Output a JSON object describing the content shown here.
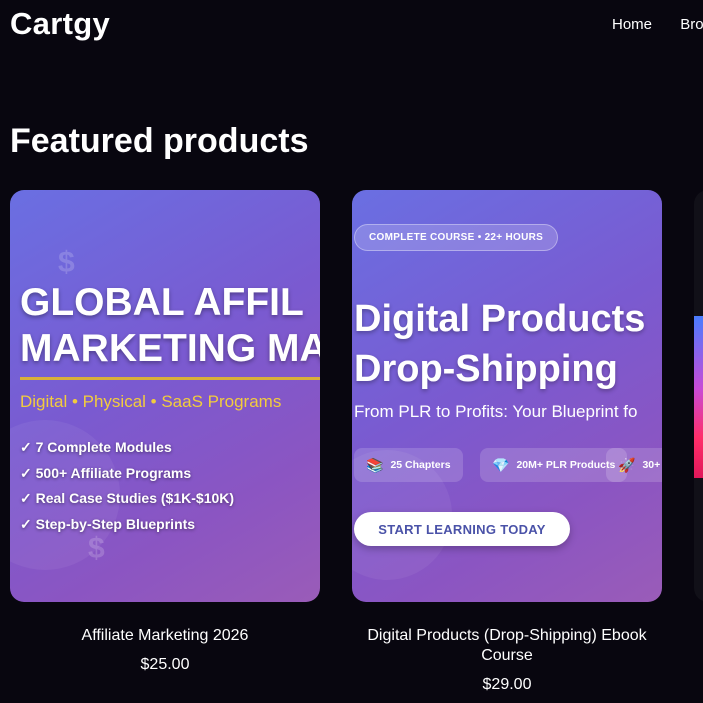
{
  "header": {
    "logo": "Cartgy",
    "nav": [
      "Home",
      "Brow"
    ]
  },
  "featured": {
    "title": "Featured products",
    "products": [
      {
        "banner": {
          "title_line1": "GLOBAL AFFIL",
          "title_line2": "MARKETING MA",
          "subtitle": "Digital • Physical • SaaS Programs",
          "features": [
            "✓ 7 Complete Modules",
            "✓ 500+ Affiliate Programs",
            "✓ Real Case Studies ($1K-$10K)",
            "✓ Step-by-Step Blueprints"
          ],
          "deco": "$"
        },
        "name": "Affiliate Marketing 2026",
        "price": "$25.00"
      },
      {
        "banner": {
          "badge": "COMPLETE COURSE • 22+ HOURS",
          "title_line1": "Digital Products",
          "title_line2": "Drop-Shipping",
          "subtitle": "From PLR to Profits: Your Blueprint fo",
          "stats": [
            {
              "icon": "📚",
              "icon_name": "books-icon",
              "label": "25 Chapters"
            },
            {
              "icon": "💎",
              "icon_name": "diamond-icon",
              "label": "20M+ PLR Products"
            },
            {
              "icon": "🚀",
              "icon_name": "rocket-icon",
              "label": "30+"
            }
          ],
          "cta": "START LEARNING TODAY"
        },
        "name": "Digital Products (Drop-Shipping) Ebook Course",
        "price": "$29.00"
      }
    ]
  }
}
